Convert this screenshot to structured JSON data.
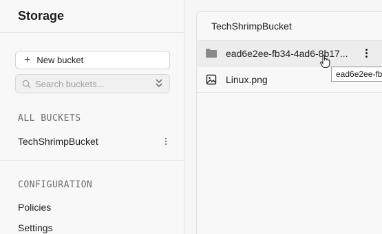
{
  "sidebar": {
    "title": "Storage",
    "new_bucket_label": "New bucket",
    "search_placeholder": "Search buckets...",
    "all_buckets_label": "ALL BUCKETS",
    "buckets": [
      {
        "name": "TechShrimpBucket"
      }
    ],
    "configuration_label": "CONFIGURATION",
    "config_links": [
      {
        "label": "Policies"
      },
      {
        "label": "Settings"
      }
    ]
  },
  "main": {
    "bucket_title": "TechShrimpBucket",
    "items": [
      {
        "name": "ead6e2ee-fb34-4ad6-8b17...",
        "type": "folder",
        "icon": "folder-icon"
      },
      {
        "name": "Linux.png",
        "type": "image",
        "icon": "image-icon"
      }
    ],
    "tooltip": "ead6e2ee-fb"
  },
  "colors": {
    "background": "#f6f6f6",
    "border": "#e3e3e3",
    "folder_icon": "#8a8a8a"
  }
}
